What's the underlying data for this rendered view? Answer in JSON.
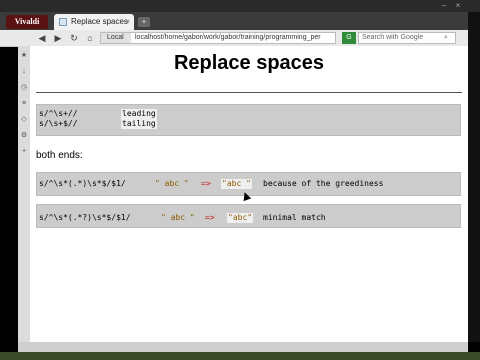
{
  "window": {
    "title": ""
  },
  "browser": {
    "logo": "Vivaldi",
    "tab": {
      "label": "Replace spaces",
      "close": "×"
    },
    "newtab": "+",
    "nav": {
      "back": "◀",
      "forward": "▶",
      "reload": "↻",
      "home": "⌂"
    },
    "urlbar": {
      "identity": "Local",
      "url": "localhost/home/gabor/work/gabor/training/programming_per"
    },
    "search": {
      "engine": "G",
      "placeholder": "Search with Google"
    }
  },
  "page": {
    "heading": "Replace spaces",
    "box1": [
      {
        "code": "s/^\\s+//",
        "note": "leading"
      },
      {
        "code": "s/\\s+$//",
        "note": "tailing"
      }
    ],
    "both_ends": "both ends:",
    "box2": {
      "code": "s/^\\s*(.*)\\s*$/$1/",
      "before": "\" abc \"",
      "arrow": "=>",
      "after": "\"abc \"",
      "comment": "because of the greediness"
    },
    "box3": {
      "code": "s/^\\s*(.*?)\\s*$/$1/",
      "before": "\" abc \"",
      "arrow": "=>",
      "after": "\"abc\"",
      "comment": "minimal match"
    }
  }
}
